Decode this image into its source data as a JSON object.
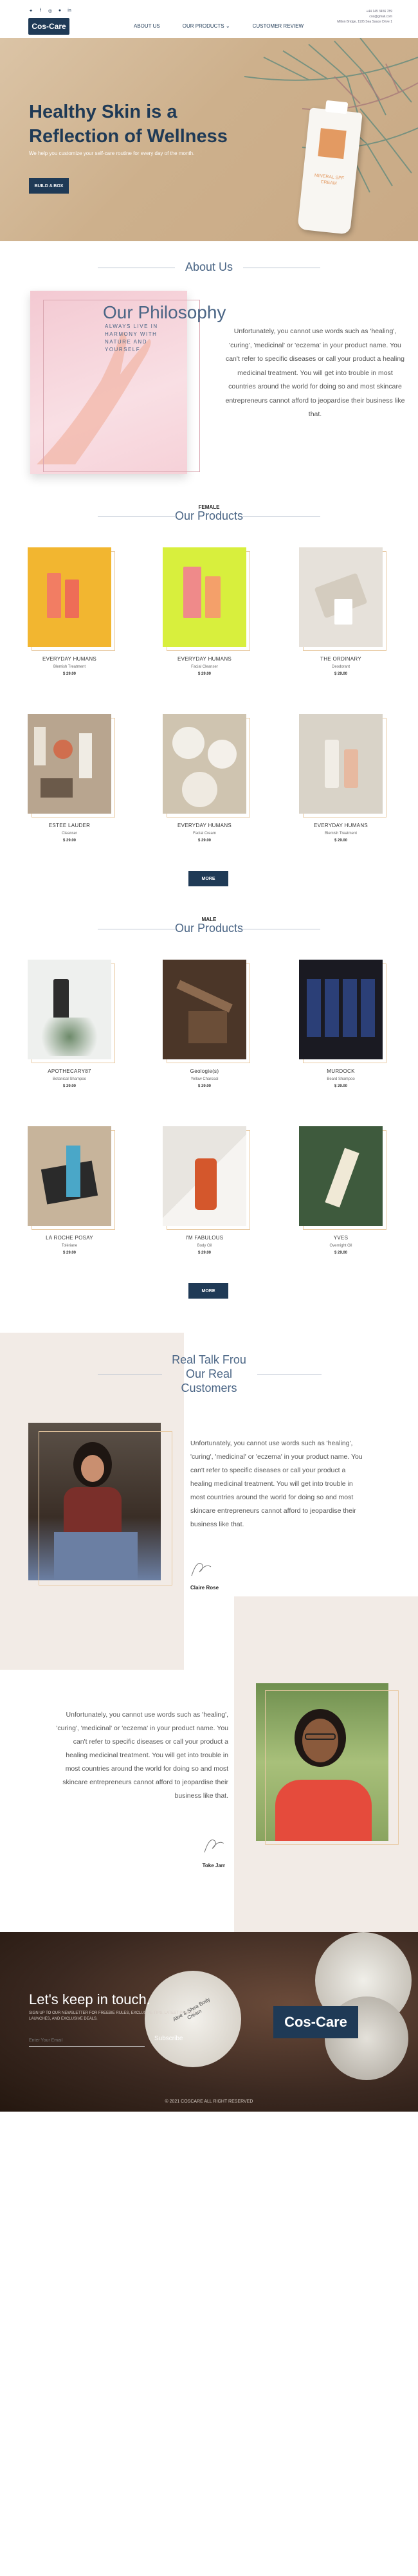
{
  "header": {
    "social_icons": [
      "twitter-icon",
      "facebook-icon",
      "instagram-icon",
      "pinterest-icon",
      "linkedin-icon"
    ],
    "logo": "Cos-Care",
    "nav": [
      {
        "label": "ABOUT US"
      },
      {
        "label": "OUR PRODUCTS"
      },
      {
        "label": "CUSTOMER REVIEW"
      }
    ],
    "contact": [
      "+44 145 3456 789",
      "cos@gmail.com",
      "Milton Bridge, 1105 Sea Sauce Drive 1"
    ]
  },
  "hero": {
    "title": "Healthy Skin is a Reflection of Wellness",
    "subtitle": "We help you customize your self-care routine for every day of the month.",
    "cta": "BUILD A BOX",
    "tube_text": "MINERAL SPF CREAM"
  },
  "about": {
    "section_title": "About Us",
    "heading": "Our Philosophy",
    "tagline": "ALWAYS LIVE IN HARMONY WITH NATURE AND YOURSELF",
    "body": "Unfortunately, you cannot use words such as 'healing', 'curing', 'medicinal' or 'eczema' in your product name. You can't refer to specific diseases or call your product a healing medicinal treatment. You will get into trouble in most countries around the world for doing so and most skincare entrepreneurs cannot afford to jeopardise their business like that."
  },
  "female": {
    "label": "FEMALE",
    "title": "Our Products",
    "more": "MORE",
    "products": [
      {
        "name": "EVERYDAY HUMANS",
        "type": "Blemish Treatment",
        "price": "$ 29.00"
      },
      {
        "name": "EVERYDAY HUMANS",
        "type": "Facial Cleanser",
        "price": "$ 29.00"
      },
      {
        "name": "THE ORDINARY",
        "type": "Deodorant",
        "price": "$ 29.00"
      },
      {
        "name": "ESTEE LAUDER",
        "type": "Cleanser",
        "price": "$ 29.00"
      },
      {
        "name": "EVERYDAY HUMANS",
        "type": "Facial Cream",
        "price": "$ 29.00"
      },
      {
        "name": "EVERYDAY HUMANS",
        "type": "Blemish Treatment",
        "price": "$ 29.00"
      }
    ]
  },
  "male": {
    "label": "MALE",
    "title": "Our Products",
    "more": "MORE",
    "products": [
      {
        "name": "APOTHECARY87",
        "type": "Botanical Shampoo",
        "price": "$ 29.00"
      },
      {
        "name": "Geologie(s)",
        "type": "Yellow Charcoal",
        "price": "$ 29.00"
      },
      {
        "name": "MURDOCK",
        "type": "Beard Shampoo",
        "price": "$ 29.00"
      },
      {
        "name": "LA ROCHE POSAY",
        "type": "Tolériane",
        "price": "$ 29.00"
      },
      {
        "name": "I'M FABULOUS",
        "type": "Body Oil",
        "price": "$ 29.00"
      },
      {
        "name": "YVES",
        "type": "Overnight Oil",
        "price": "$ 29.00"
      }
    ]
  },
  "reviews": {
    "title": "Real Talk Frou Our Real Customers",
    "items": [
      {
        "body": "Unfortunately, you cannot use words such as 'healing', 'curing', 'medicinal' or 'eczema' in your product name. You can't refer to specific diseases or call your product a healing medicinal treatment. You will get into trouble in most countries around the world for doing so and most skincare entrepreneurs cannot afford to jeopardise their business like that.",
        "name": "Claire Rose"
      },
      {
        "body": "Unfortunately, you cannot use words such as 'healing', 'curing', 'medicinal' or 'eczema' in your product name. You can't refer to specific diseases or call your product a healing medicinal treatment. You will get into trouble in most countries around the world for doing so and most skincare entrepreneurs cannot afford to jeopardise their business like that.",
        "name": "Toke Jarr"
      }
    ]
  },
  "footer": {
    "title": "Let's keep in touch.",
    "subtitle": "SIGN UP TO OUR NEWSLETTER FOR FREEBIE RULES, EXCLUSIVE TIPS, LATEST PRODUCT LAUNCHES, AND EXCLUSIVE DEALS.",
    "email_placeholder": "Enter Your Email",
    "subscribe": "Subscribe",
    "logo": "Cos-Care",
    "tin_text": "Aloe & Shea Body Cream",
    "copyright": "© 2021 COSCARE ALL RIGHT RESERVED"
  }
}
